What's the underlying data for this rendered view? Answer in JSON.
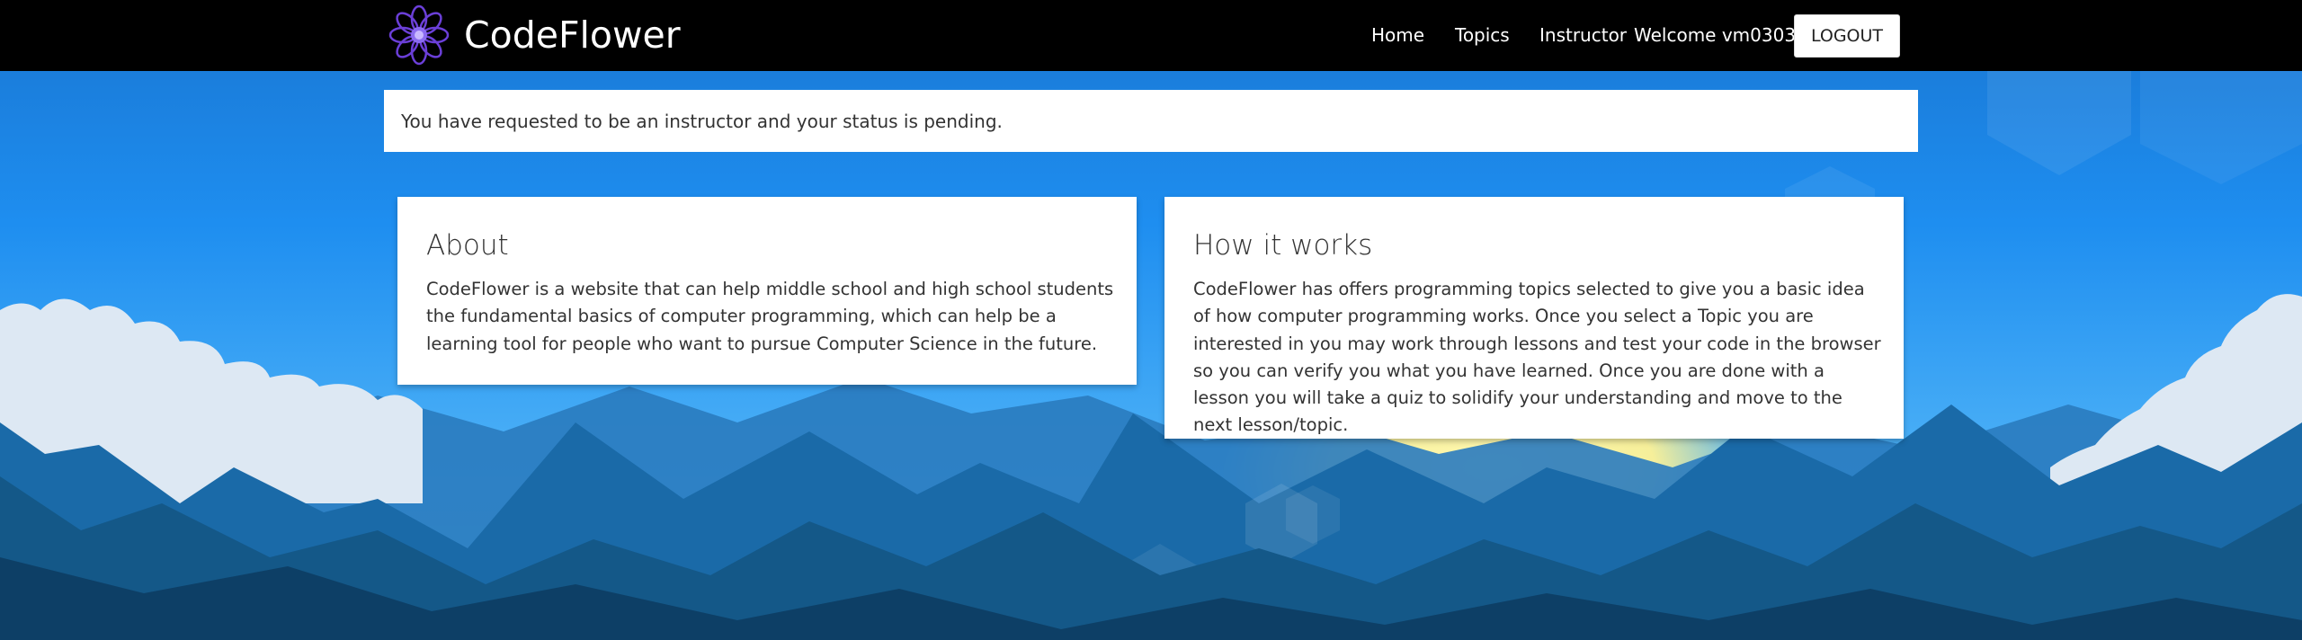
{
  "brand": {
    "name": "CodeFlower",
    "logo": "flower-logo"
  },
  "nav": {
    "home": "Home",
    "topics": "Topics",
    "instructor": "Instructor",
    "welcome": "Welcome vm0303",
    "logout": "LOGOUT"
  },
  "alert": {
    "text": "You have requested to be an instructor and your status is pending."
  },
  "cards": {
    "about": {
      "title": "About",
      "body": "CodeFlower is a website that can help middle school and high school students the fundamental basics of computer programming, which can help be a learning tool for people who want to pursue Computer Science in the future."
    },
    "how": {
      "title": "How it works",
      "body": "CodeFlower has offers programming topics selected to give you a basic idea of how computer programming works. Once you select a Topic you are interested in you may work through lessons and test your code in the browser so you can verify you what you have learned. Once you are done with a lesson you will take a quiz to solidify your understanding and move to the next lesson/topic."
    }
  },
  "colors": {
    "navbar": "#000000",
    "sky_top": "#1565c0",
    "sky_mid": "#2196f3",
    "sun": "#fff59d",
    "mountain_dark": "#0d3f66",
    "mountain_mid": "#1a5f92",
    "mountain_light": "#2a7bbf",
    "cloud": "#dfe9f3"
  }
}
